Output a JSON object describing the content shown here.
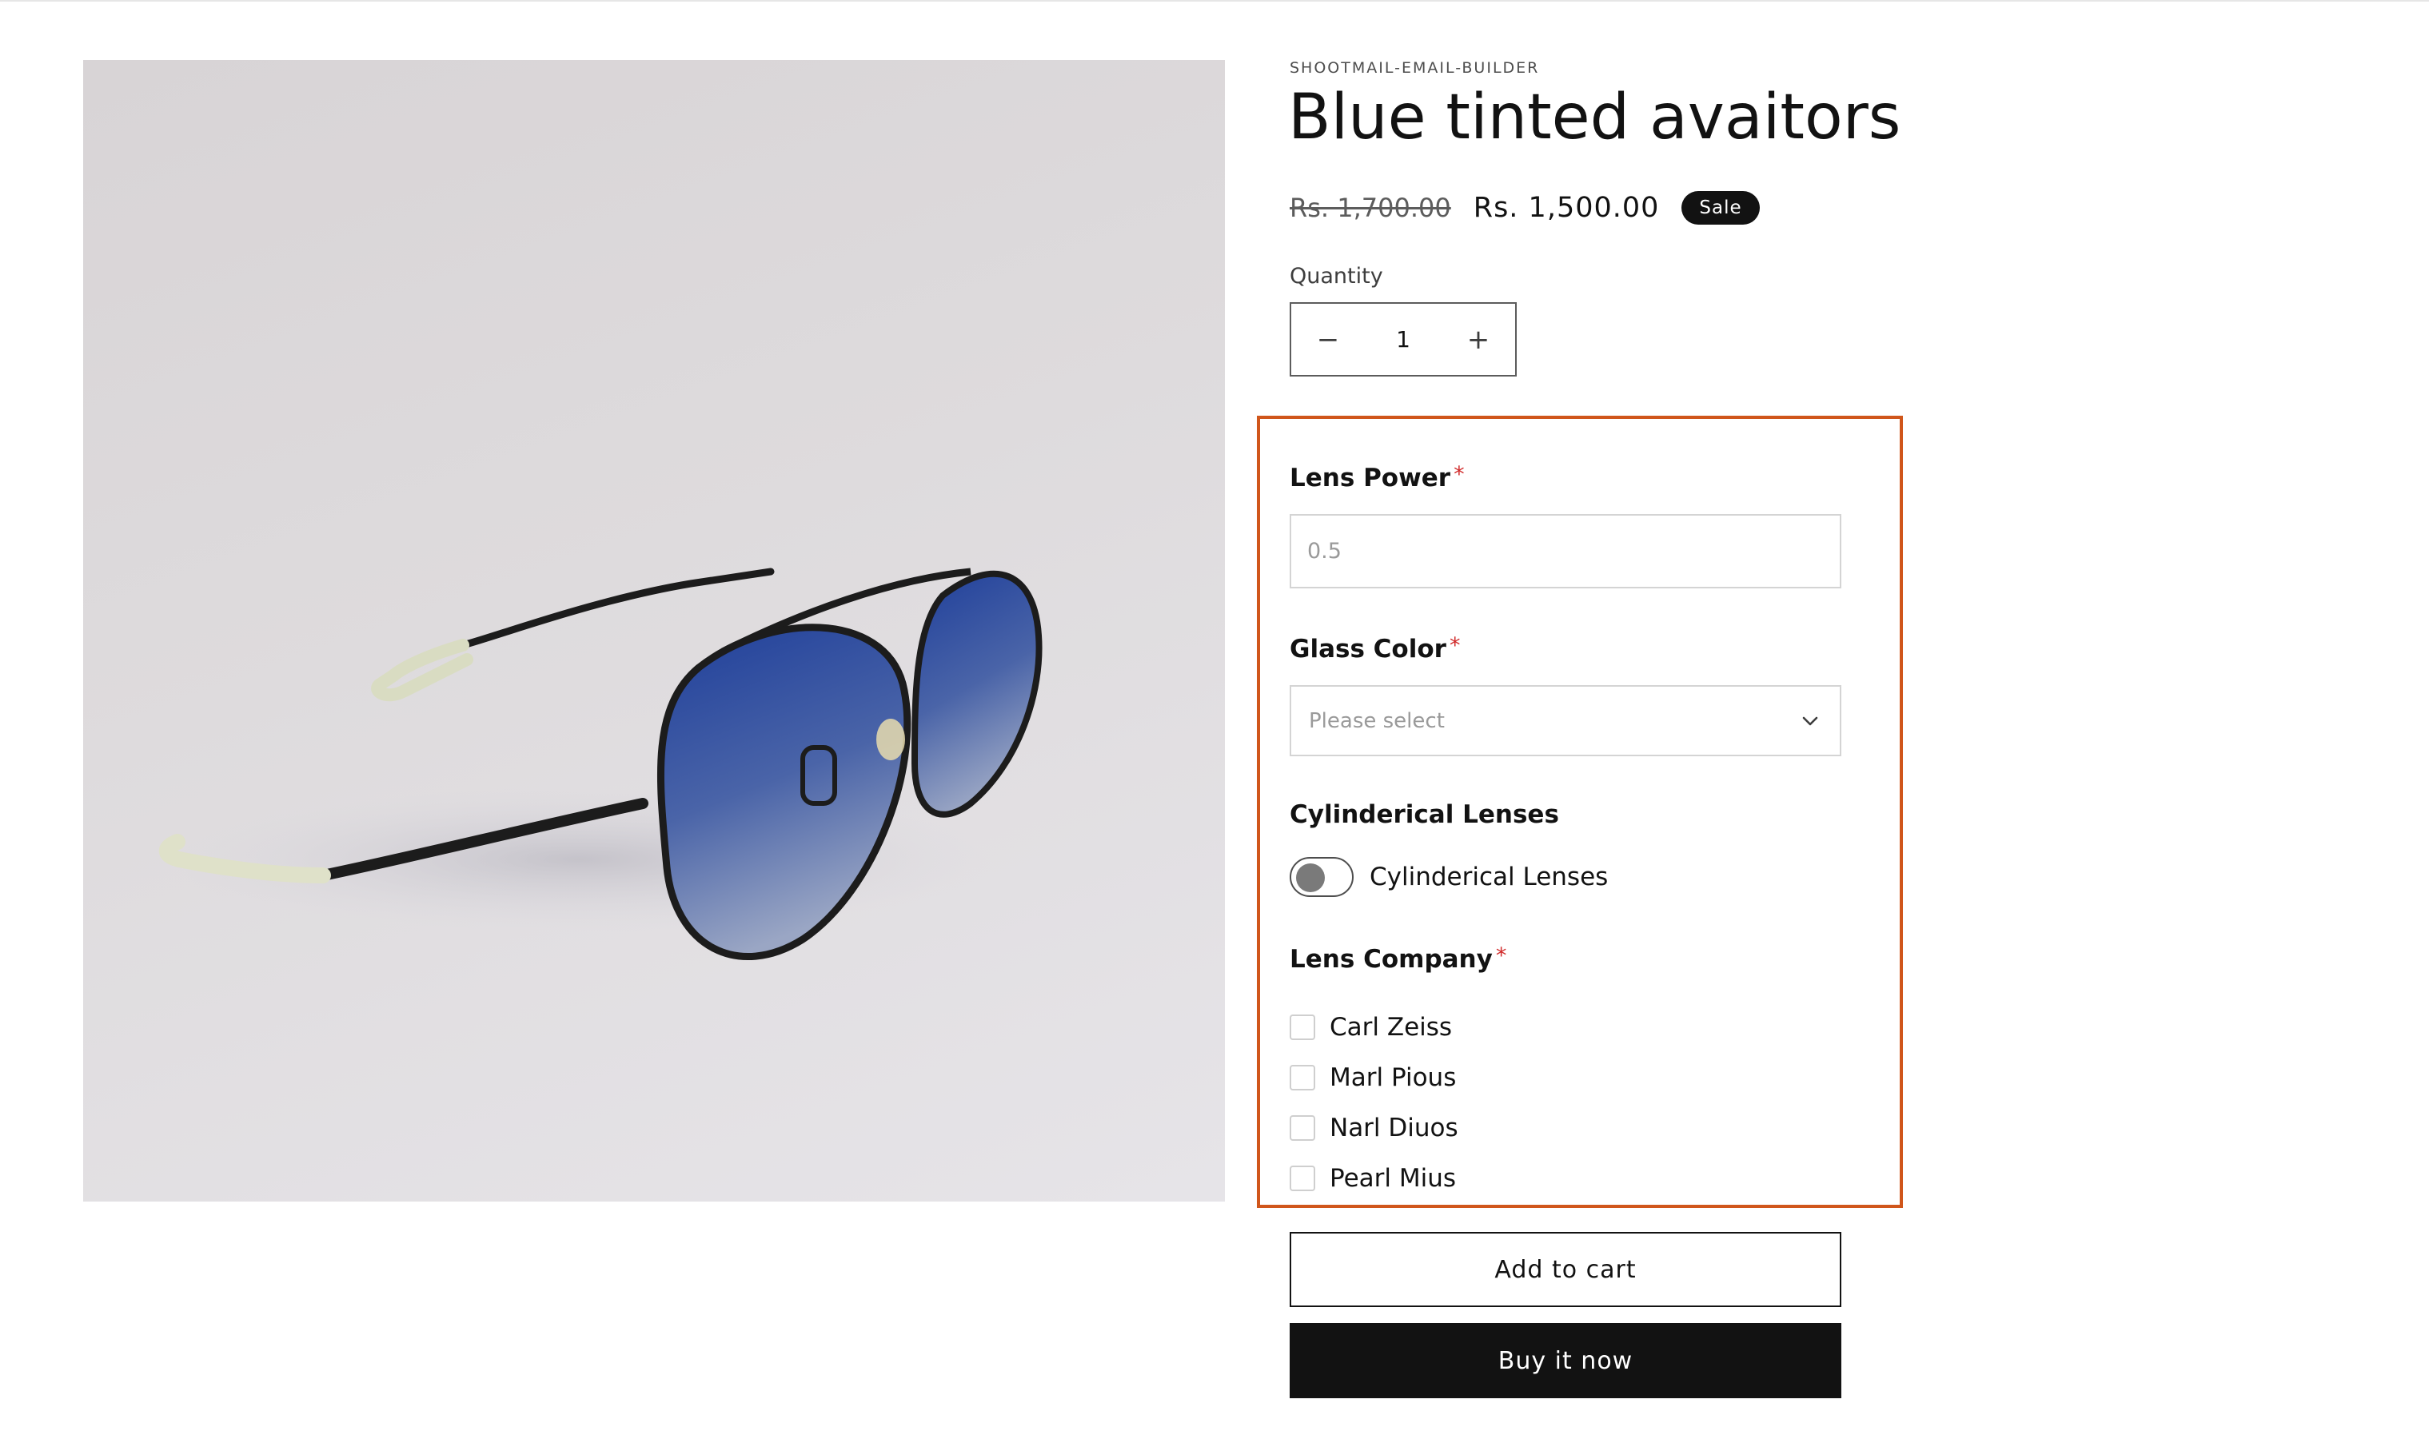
{
  "product": {
    "vendor": "SHOOTMAIL-EMAIL-BUILDER",
    "title": "Blue tinted avaitors",
    "price_compare": "Rs. 1,700.00",
    "price_sale": "Rs. 1,500.00",
    "badge": "Sale",
    "image_icon": "sunglasses-photo"
  },
  "quantity": {
    "label": "Quantity",
    "value": "1",
    "decrease_symbol": "−",
    "increase_symbol": "+"
  },
  "options": {
    "highlight_color": "#d0561b",
    "lens_power": {
      "label": "Lens Power",
      "required": "*",
      "placeholder": "0.5"
    },
    "glass_color": {
      "label": "Glass Color",
      "required": "*",
      "placeholder": "Please select"
    },
    "cylinderical": {
      "label": "Cylinderical Lenses",
      "toggle_label": "Cylinderical Lenses",
      "checked": false
    },
    "lens_company": {
      "label": "Lens Company",
      "required": "*",
      "items": [
        {
          "label": "Carl Zeiss"
        },
        {
          "label": "Marl Pious"
        },
        {
          "label": "Narl Diuos"
        },
        {
          "label": "Pearl Mius"
        }
      ]
    }
  },
  "actions": {
    "add_to_cart": "Add to cart",
    "buy_now": "Buy it now"
  }
}
